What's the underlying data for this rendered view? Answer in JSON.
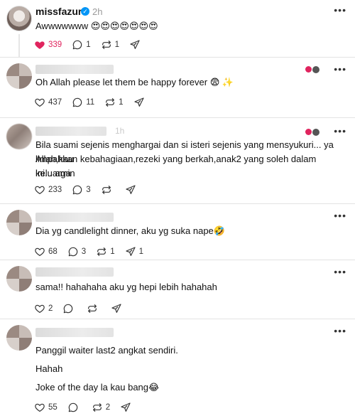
{
  "main_post": {
    "username": "missfazura",
    "time": "2h",
    "text": "Awwwwwww 😍😍😍😍😍😍😍",
    "likes": "339",
    "replies": "1",
    "reposts": "1"
  },
  "comments": [
    {
      "time": "",
      "lines": [
        "Oh Allah please let them be happy forever 😨 ✨"
      ],
      "likes": "437",
      "replies": "11",
      "reposts": "1",
      "shares": ""
    },
    {
      "time": "1h",
      "lines": [
        "Bila suami sejenis menghargai dan si isteri sejenis yang mensyukuri... ya Allah,kau",
        "limpahkan kebahagiaan,rezeki yang berkah,anak2 yang soleh dalam keluarga",
        "ini... amin"
      ],
      "likes": "233",
      "replies": "3",
      "reposts": "",
      "shares": ""
    },
    {
      "time": "",
      "lines": [
        "Dia yg candlelight dinner, aku yg suka nape🤣"
      ],
      "likes": "68",
      "replies": "3",
      "reposts": "1",
      "shares": "1"
    },
    {
      "time": "",
      "lines": [
        "sama!! hahahaha aku yg hepi lebih hahahah"
      ],
      "likes": "2",
      "replies": "",
      "reposts": "",
      "shares": ""
    },
    {
      "time": "",
      "lines": [
        "Panggil waiter last2 angkat sendiri.",
        "Hahah",
        "Joke of the day la kau bang😂"
      ],
      "likes": "55",
      "replies": "",
      "reposts": "2",
      "shares": ""
    }
  ],
  "icons": {
    "like": "heart-icon",
    "reply": "comment-bubble-icon",
    "repost": "repost-icon",
    "share": "send-icon",
    "more": "more-dots-icon",
    "verified": "verified-badge-icon"
  },
  "colors": {
    "liked": "#e0245e",
    "verified": "#0095f6",
    "divider": "#e3e3e3"
  }
}
